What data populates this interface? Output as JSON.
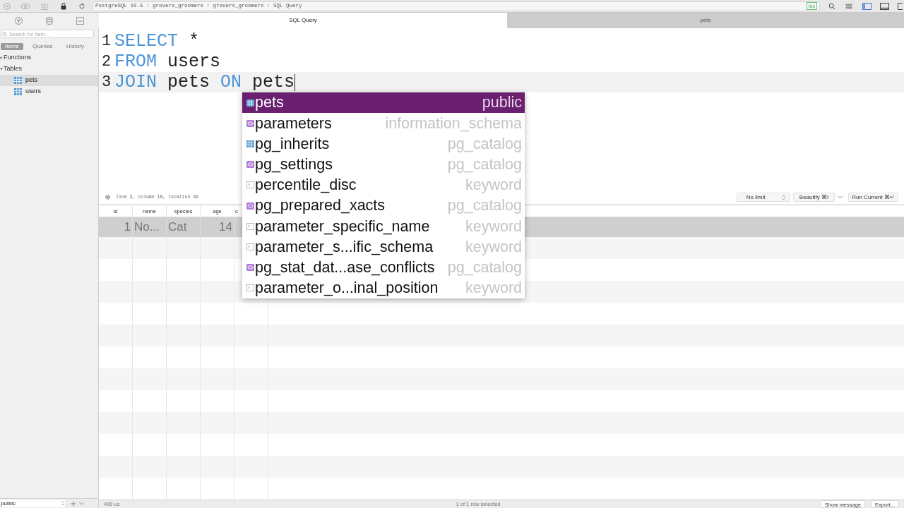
{
  "toolbar": {
    "address": "PostgreSQL 10.5 : grovers_groomers : grovers_groomers : SQL Query",
    "badge": "loc"
  },
  "tabs": [
    {
      "label": "SQL Query",
      "selected": true
    },
    {
      "label": "pets",
      "selected": false
    }
  ],
  "sidebar": {
    "search": {
      "placeholder": "Search for item..."
    },
    "tabs": [
      {
        "label": "Items",
        "selected": true
      },
      {
        "label": "Queries",
        "selected": false
      },
      {
        "label": "History",
        "selected": false
      }
    ],
    "tree": [
      {
        "label": "Functions",
        "expanded": false
      },
      {
        "label": "Tables",
        "expanded": true,
        "children": [
          {
            "label": "pets",
            "selected": true
          },
          {
            "label": "users",
            "selected": false
          }
        ]
      }
    ],
    "schema": "public"
  },
  "editor": {
    "lines": [
      {
        "number": "1",
        "current": false,
        "tokens": [
          {
            "kind": "keyword",
            "text": "SELECT"
          },
          {
            "kind": "plain",
            "text": " *"
          }
        ]
      },
      {
        "number": "2",
        "current": false,
        "tokens": [
          {
            "kind": "keyword",
            "text": "FROM"
          },
          {
            "kind": "plain",
            "text": " users"
          }
        ]
      },
      {
        "number": "3",
        "current": true,
        "tokens": [
          {
            "kind": "keyword",
            "text": "JOIN"
          },
          {
            "kind": "plain",
            "text": " pets "
          },
          {
            "kind": "keyword",
            "text": "ON"
          },
          {
            "kind": "plain",
            "text": " pets"
          }
        ]
      }
    ],
    "autocomplete": [
      {
        "kind": "table",
        "name": "pets",
        "schema": "public",
        "selected": true
      },
      {
        "kind": "view",
        "name": "parameters",
        "schema": "information_schema",
        "selected": false
      },
      {
        "kind": "table",
        "name": "pg_inherits",
        "schema": "pg_catalog",
        "selected": false
      },
      {
        "kind": "view",
        "name": "pg_settings",
        "schema": "pg_catalog",
        "selected": false
      },
      {
        "kind": "keyword",
        "name": "percentile_disc",
        "schema": "keyword",
        "selected": false
      },
      {
        "kind": "view",
        "name": "pg_prepared_xacts",
        "schema": "pg_catalog",
        "selected": false
      },
      {
        "kind": "keyword",
        "name": "parameter_specific_name",
        "schema": "keyword",
        "selected": false
      },
      {
        "kind": "keyword",
        "name": "parameter_s...ific_schema",
        "schema": "keyword",
        "selected": false
      },
      {
        "kind": "view",
        "name": "pg_stat_dat...ase_conflicts",
        "schema": "pg_catalog",
        "selected": false
      },
      {
        "kind": "keyword",
        "name": "parameter_o...inal_position",
        "schema": "keyword",
        "selected": false
      }
    ]
  },
  "status": {
    "position": "line 3, column 18, location 39",
    "limit": "No limit",
    "beautify": "Beautify ⌘I",
    "run": "Run Current ⌘↵"
  },
  "table": {
    "columns": [
      "id",
      "name",
      "species",
      "age",
      "c"
    ],
    "rows": [
      {
        "selected": true,
        "cells": [
          "1",
          "No...",
          "Cat",
          "14"
        ]
      }
    ]
  },
  "status_bar": {
    "timing": "499 us",
    "selection": "1 of 1 row selected",
    "buttons": [
      "Show message",
      "Export..."
    ]
  }
}
